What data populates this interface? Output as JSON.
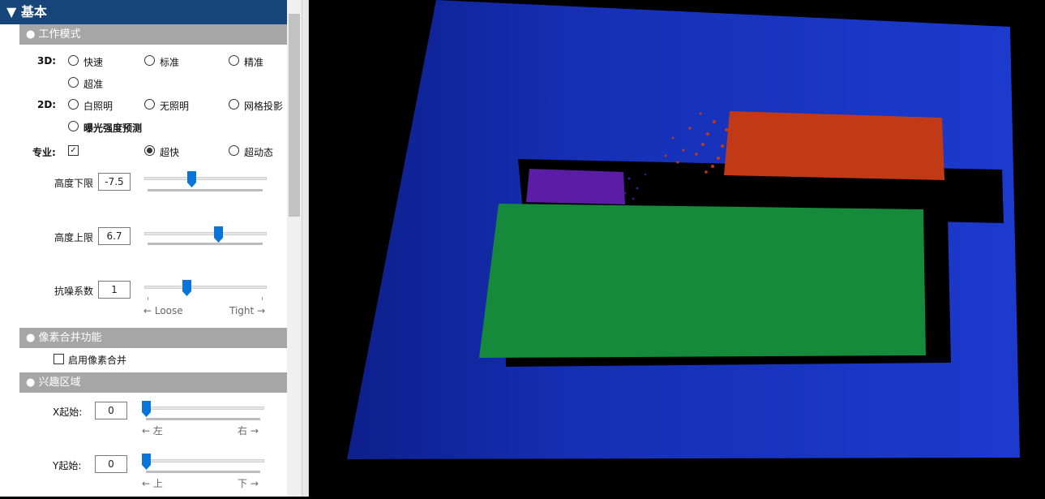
{
  "panel": {
    "header": "▼ 基本",
    "section_mode": "● 工作模式",
    "label_3d": "3D:",
    "opt_fast": "快速",
    "opt_standard": "标准",
    "opt_precise": "精准",
    "opt_ultra": "超准",
    "label_2d": "2D:",
    "opt_white": "白照明",
    "opt_no_light": "无照明",
    "opt_grid": "网格投影",
    "opt_exposure": "曝光强度预测",
    "label_pro": "专业:",
    "opt_super_fast": "超快",
    "opt_hdr": "超动态",
    "height_low_label": "高度下限",
    "height_low_value": "-7.5",
    "height_high_label": "高度上限",
    "height_high_value": "6.7",
    "noise_label": "抗噪系数",
    "noise_value": "1",
    "loose": "← Loose",
    "tight": "Tight →",
    "section_binning": "● 像素合并功能",
    "binning_label": "启用像素合并",
    "section_roi": "● 兴趣区域",
    "x_start_label": "X起始:",
    "x_start_value": "0",
    "left_hint": "← 左",
    "right_hint": "右 →",
    "y_start_label": "Y起始:",
    "y_start_value": "0",
    "up_hint": "← 上",
    "down_hint": "下 →"
  },
  "state": {
    "mode_2d_selected": "none",
    "pro_checked": true,
    "pro_selected": "超快",
    "binning_checked": false
  },
  "colors": {
    "header_bg": "#16457a",
    "section_bg": "#a6a6a6",
    "slider_thumb": "#0a74d8",
    "plane_blue": "#1328b8",
    "box_red": "#c33a14",
    "box_purple": "#5a1aa6",
    "box_green": "#15893a"
  }
}
